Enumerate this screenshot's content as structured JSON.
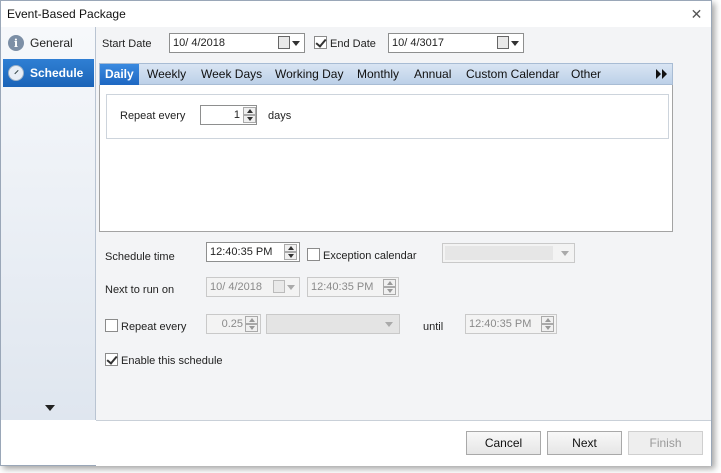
{
  "window": {
    "title": "Event-Based Package",
    "close_glyph": "✕"
  },
  "sidebar": {
    "items": [
      {
        "label": "General",
        "icon": "info-icon",
        "glyph": "i",
        "selected": false
      },
      {
        "label": "Schedule",
        "icon": "clock-icon",
        "glyph": "",
        "selected": true
      }
    ]
  },
  "dates": {
    "start_label": "Start Date",
    "start_value": "10/  4/2018",
    "end_checked": true,
    "end_label": "End Date",
    "end_value": "10/  4/3017"
  },
  "tabs": [
    {
      "label": "Daily",
      "active": true
    },
    {
      "label": "Weekly",
      "active": false
    },
    {
      "label": "Week Days",
      "active": false
    },
    {
      "label": "Working Day",
      "active": false
    },
    {
      "label": "Monthly",
      "active": false
    },
    {
      "label": "Annual",
      "active": false
    },
    {
      "label": "Custom Calendar",
      "active": false
    },
    {
      "label": "Other",
      "active": false
    }
  ],
  "daily": {
    "repeat_label": "Repeat every",
    "repeat_value": "1",
    "unit": "days"
  },
  "schedule": {
    "time_label": "Schedule time",
    "time_value": "12:40:35 PM",
    "exception_checked": false,
    "exception_label": "Exception calendar",
    "exception_value": "",
    "next_run_label": "Next to run on",
    "next_run_date": "10/  4/2018",
    "next_run_time": "12:40:35 PM",
    "repeat_checked": false,
    "repeat_label": "Repeat every",
    "repeat_value": "0.25",
    "repeat_unit": "",
    "until_label": "until",
    "until_value": "12:40:35 PM",
    "enable_checked": true,
    "enable_label": "Enable this schedule"
  },
  "footer": {
    "cancel": "Cancel",
    "next": "Next",
    "finish": "Finish"
  },
  "colors": {
    "accent": "#1e67c2",
    "tab_bar": "#c8d9ee",
    "content_bg": "#f3f4f6"
  }
}
